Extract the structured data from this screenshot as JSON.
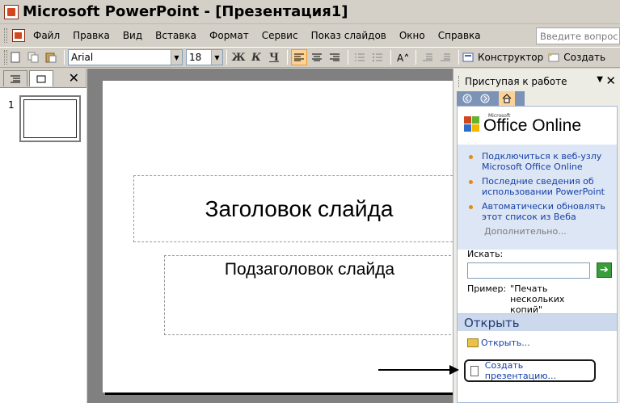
{
  "window": {
    "title": "Microsoft PowerPoint - [Презентация1]"
  },
  "menu": {
    "items": [
      "Файл",
      "Правка",
      "Вид",
      "Вставка",
      "Формат",
      "Сервис",
      "Показ слайдов",
      "Окно",
      "Справка"
    ],
    "help_placeholder": "Введите вопрос"
  },
  "toolbar": {
    "font_name": "Arial",
    "font_size": "18",
    "bold": "Ж",
    "italic": "К",
    "underline": "Ч",
    "designer_label": "Конструктор",
    "create_label": "Создать"
  },
  "slides_pane": {
    "slide_number": "1"
  },
  "slide": {
    "title_placeholder": "Заголовок слайда",
    "subtitle_placeholder": "Подзаголовок слайда"
  },
  "taskpane": {
    "title": "Приступая к работе",
    "logo_text": "Office Online",
    "logo_small": "Microsoft",
    "links": [
      "Подключиться к веб-узлу Microsoft Office Online",
      "Последние сведения об использовании PowerPoint",
      "Автоматически обновлять этот список из Веба"
    ],
    "more_label": "Дополнительно...",
    "search_label": "Искать:",
    "example_label": "Пример:",
    "example_value": "\"Печать нескольких копий\"",
    "open_section": "Открыть",
    "open_link": "Открыть...",
    "new_presentation": "Создать презентацию..."
  }
}
